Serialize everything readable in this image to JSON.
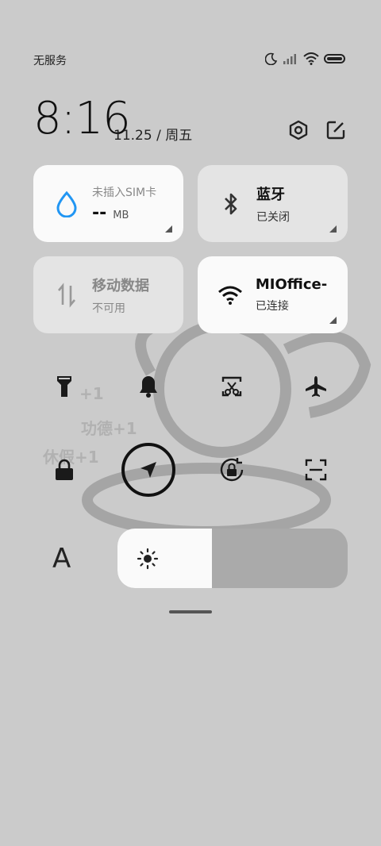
{
  "status_bar": {
    "carrier": "无服务",
    "icons": [
      "moon-icon",
      "signal-icon",
      "wifi-icon",
      "battery-icon"
    ]
  },
  "header": {
    "time": "8:16",
    "date": "11.25 / 周五",
    "icons": [
      "settings-icon",
      "edit-icon"
    ]
  },
  "tiles": {
    "sim": {
      "title": "未插入SIM卡",
      "value": "--",
      "unit": "MB",
      "icon": "water-drop-icon"
    },
    "bluetooth": {
      "title": "蓝牙",
      "status": "已关闭",
      "icon": "bluetooth-icon"
    },
    "mobile_data": {
      "title": "移动数据",
      "status": "不可用",
      "icon": "data-arrows-icon"
    },
    "wifi": {
      "title": "MIOffice-",
      "status": "已连接",
      "icon": "wifi-icon"
    }
  },
  "toggles": [
    "flashlight-icon",
    "bell-icon",
    "screenshot-icon",
    "airplane-icon",
    "lock-icon",
    "location-icon",
    "rotation-lock-icon",
    "scan-icon"
  ],
  "watermark_text": [
    "功德+1",
    "休假+1",
    "+1"
  ],
  "brightness": {
    "level": 0.41,
    "icon": "sun-icon"
  },
  "font_button": {
    "label": "A"
  },
  "colors": {
    "background": "#cbcbcb",
    "tile_white": "#fafafa",
    "tile_grey": "#e4e4e4",
    "accent_blue": "#2196f3"
  }
}
